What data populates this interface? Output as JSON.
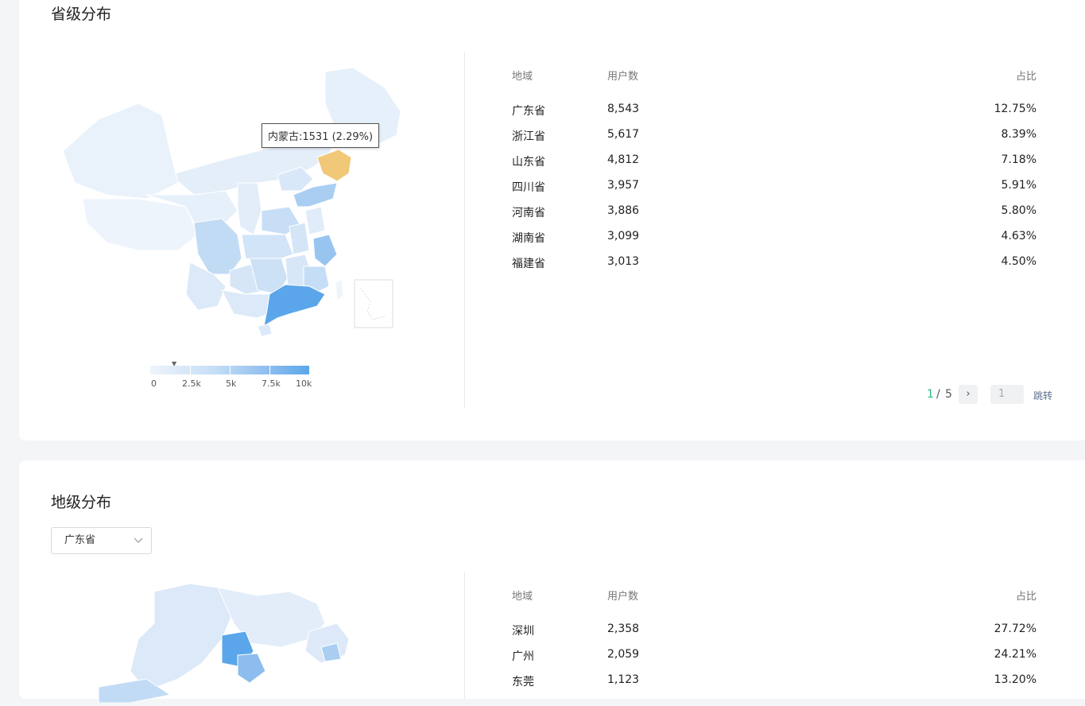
{
  "province_section": {
    "title": "省级分布",
    "tooltip": "内蒙古:1531 (2.29%)",
    "legend": [
      "0",
      "2.5k",
      "5k",
      "7.5k",
      "10k"
    ],
    "headers": {
      "region": "地域",
      "users": "用户数",
      "share": "占比"
    },
    "rows": [
      {
        "region": "广东省",
        "users": "8,543",
        "share": "12.75%"
      },
      {
        "region": "浙江省",
        "users": "5,617",
        "share": "8.39%"
      },
      {
        "region": "山东省",
        "users": "4,812",
        "share": "7.18%"
      },
      {
        "region": "四川省",
        "users": "3,957",
        "share": "5.91%"
      },
      {
        "region": "河南省",
        "users": "3,886",
        "share": "5.80%"
      },
      {
        "region": "湖南省",
        "users": "3,099",
        "share": "4.63%"
      },
      {
        "region": "福建省",
        "users": "3,013",
        "share": "4.50%"
      }
    ],
    "pager": {
      "current": "1",
      "separator": "/",
      "total": "5",
      "next": "›",
      "input_placeholder": "1",
      "jump": "跳转"
    }
  },
  "city_section": {
    "title": "地级分布",
    "select_value": "广东省",
    "headers": {
      "region": "地域",
      "users": "用户数",
      "share": "占比"
    },
    "rows": [
      {
        "region": "深圳",
        "users": "2,358",
        "share": "27.72%"
      },
      {
        "region": "广州",
        "users": "2,059",
        "share": "24.21%"
      },
      {
        "region": "东莞",
        "users": "1,123",
        "share": "13.20%"
      }
    ]
  },
  "colors": {
    "highlight": "#f0c878",
    "max": "#5ba6ea",
    "accent": "#2db87d"
  }
}
